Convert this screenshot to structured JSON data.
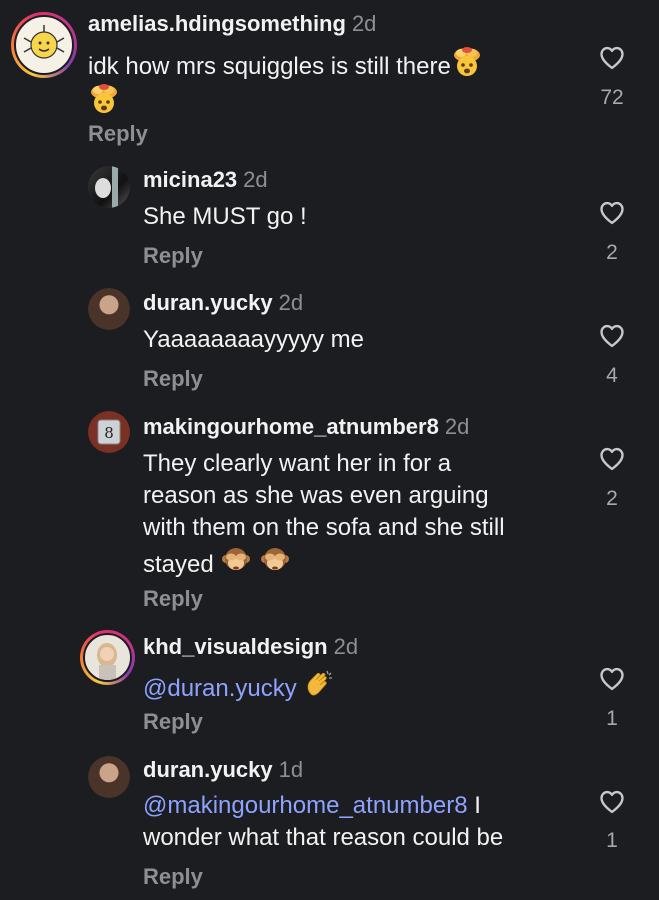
{
  "comments": [
    {
      "username": "amelias.hdingsomething",
      "time": "2d",
      "text_pre": "idk how mrs squiggles is still there",
      "likes": "72",
      "reply_label": "Reply",
      "avatar_icon": "cartoon-sunshine-avatar"
    },
    {
      "username": "micina23",
      "time": "2d",
      "text_pre": "She MUST go !",
      "likes": "2",
      "reply_label": "Reply",
      "avatar_icon": "photo-avatar"
    },
    {
      "username": "duran.yucky",
      "time": "2d",
      "text_pre": "Yaaaaaaaayyyyy me",
      "likes": "4",
      "reply_label": "Reply",
      "avatar_icon": "photo-avatar"
    },
    {
      "username": "makingourhome_atnumber8",
      "time": "2d",
      "text_lines": [
        "They clearly want her in for a",
        "reason as she was even arguing",
        "with them on the sofa and she still",
        "stayed"
      ],
      "likes": "2",
      "reply_label": "Reply",
      "avatar_icon": "house-number-8-avatar"
    },
    {
      "username": "khd_visualdesign",
      "time": "2d",
      "mention": "@duran.yucky",
      "likes": "1",
      "reply_label": "Reply",
      "avatar_icon": "portrait-avatar"
    },
    {
      "username": "duran.yucky",
      "time": "1d",
      "mention": "@makingourhome_atnumber8",
      "text_after_mention": "I",
      "text_line2": "wonder what that reason could be",
      "likes": "1",
      "reply_label": "Reply",
      "avatar_icon": "photo-avatar"
    }
  ],
  "colors": {
    "background": "#1b1d21",
    "text": "#f2f2f2",
    "muted": "#8e8e93",
    "mention": "#8ea3ff"
  }
}
